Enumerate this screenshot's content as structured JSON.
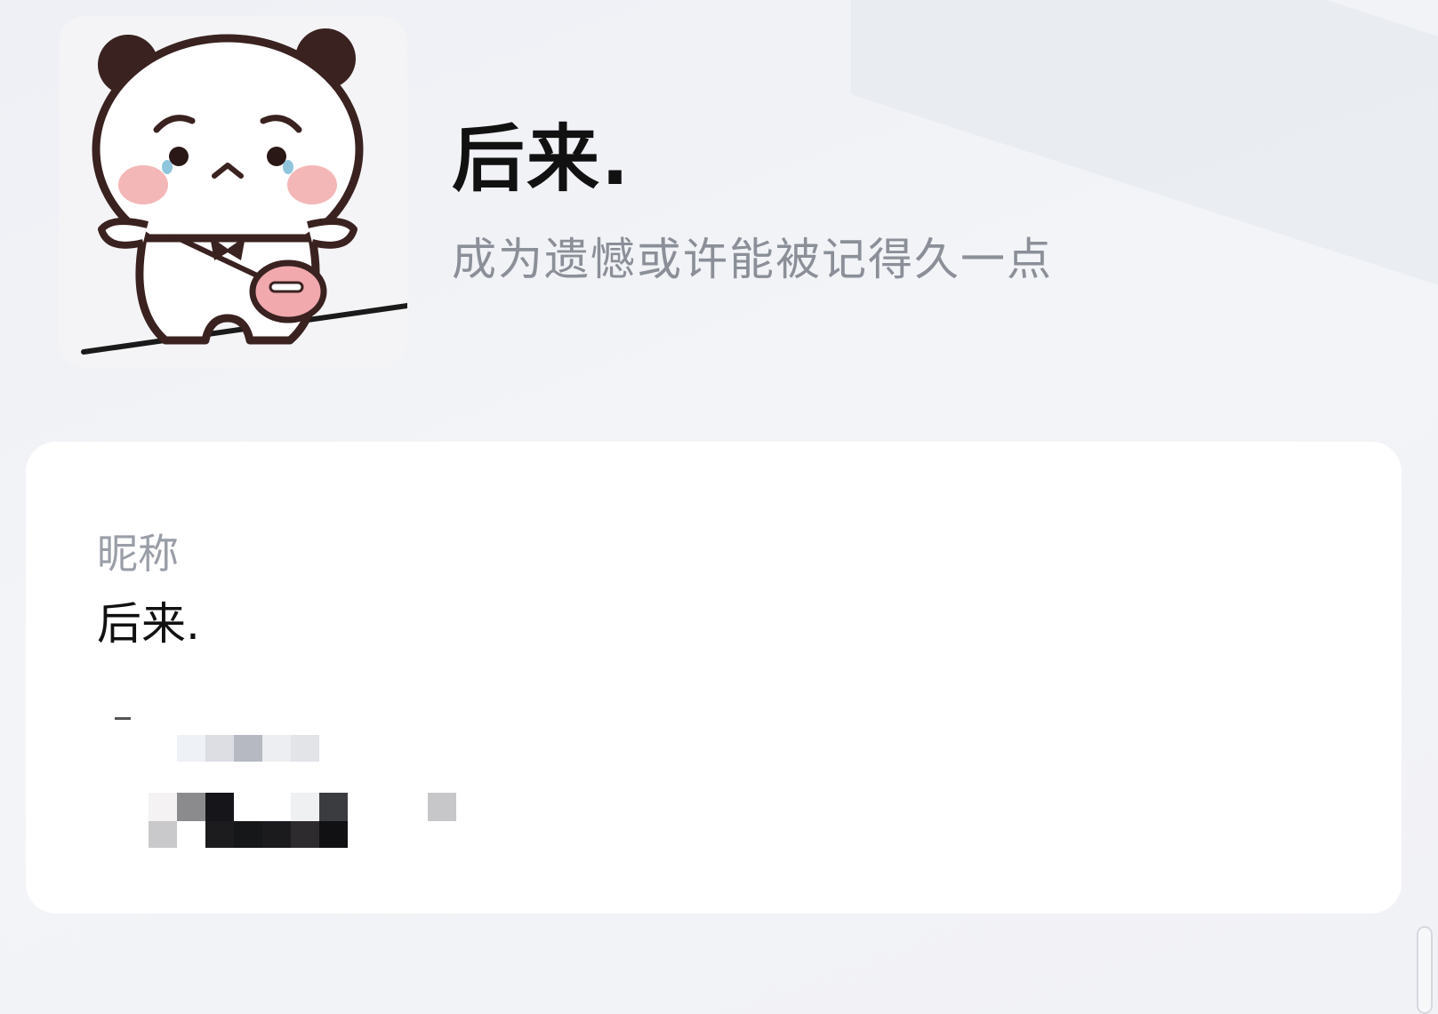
{
  "profile": {
    "name": "后来.",
    "signature": "成为遗憾或许能被记得久一点"
  },
  "card": {
    "nickname_label": "昵称",
    "nickname_value": "后来."
  },
  "colors": {
    "background": "#f1f2f6",
    "card": "#ffffff",
    "label": "#9a9ea7",
    "text": "#111111",
    "signature": "#8b8f98"
  },
  "icons": {
    "avatar": "cartoon-panda-avatar"
  }
}
